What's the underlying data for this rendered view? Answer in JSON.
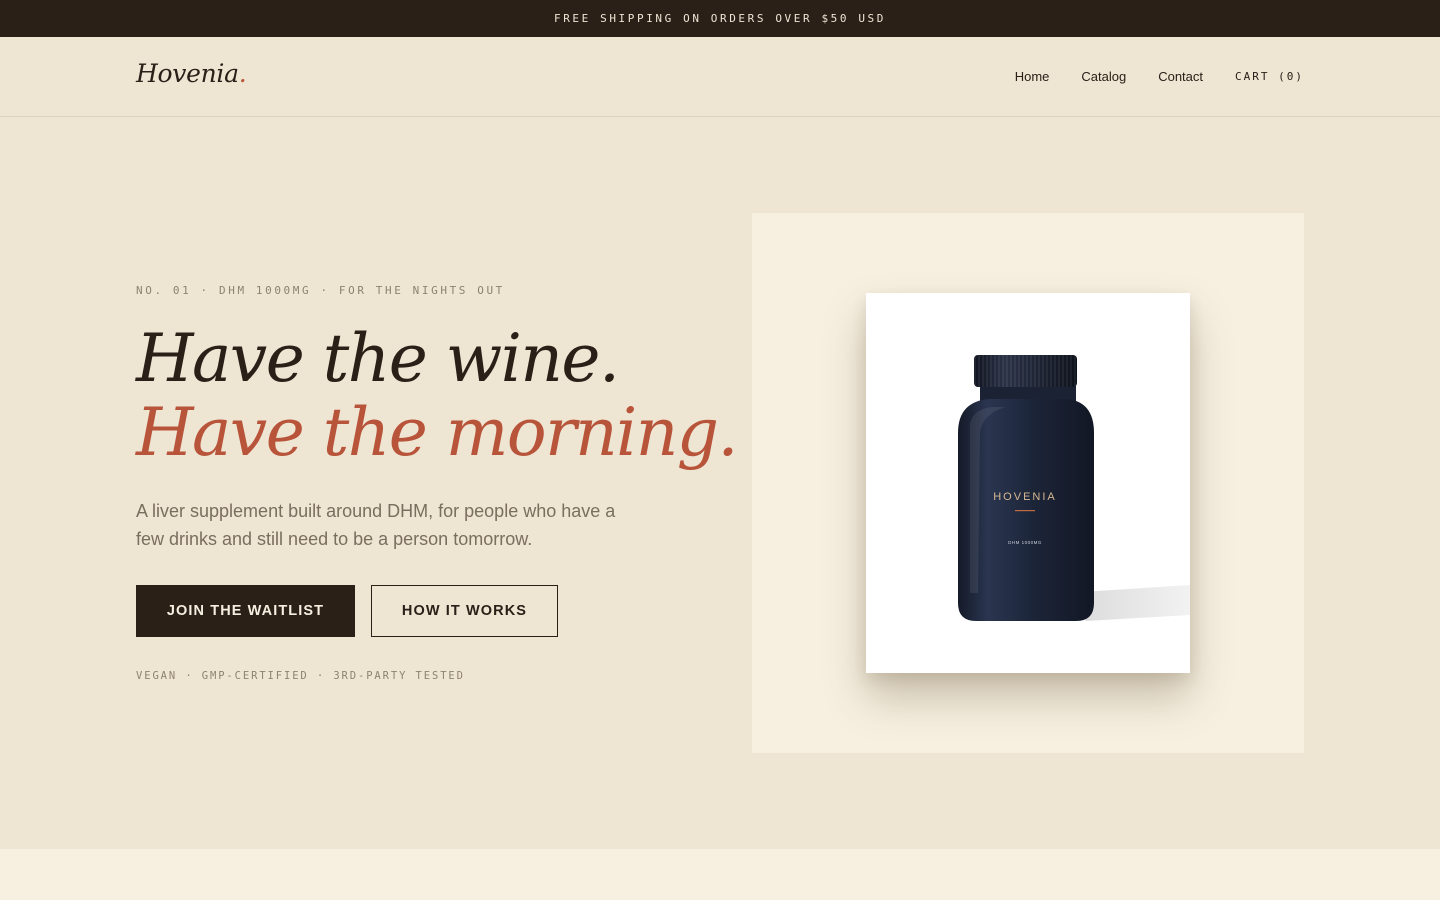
{
  "announcement": {
    "text": "FREE SHIPPING ON ORDERS OVER $50 USD"
  },
  "header": {
    "logo": "Hovenia",
    "logo_dot": ".",
    "nav": [
      {
        "label": "Home"
      },
      {
        "label": "Catalog"
      },
      {
        "label": "Contact"
      }
    ],
    "cart": "CART (0)"
  },
  "hero": {
    "eyebrow": "NO. 01 · DHM 1000MG · FOR THE NIGHTS OUT",
    "headline_line1": "Have the wine.",
    "headline_line2": "Have the morning.",
    "subcopy": "A liver supplement built around DHM, for people who have a few drinks and still need to be a person tomorrow.",
    "primary_cta": "JOIN THE WAITLIST",
    "secondary_cta": "HOW IT WORKS",
    "trust_line": "VEGAN · GMP-CERTIFIED · 3RD-PARTY TESTED"
  },
  "product": {
    "brand_label": "HOVENIA",
    "dose_label": "DHM 1000MG"
  },
  "colors": {
    "background": "#EEE5D3",
    "dark": "#2A2018",
    "accent": "#B8543A",
    "panel": "#F7F0E1",
    "bottle": "#1C2538"
  }
}
